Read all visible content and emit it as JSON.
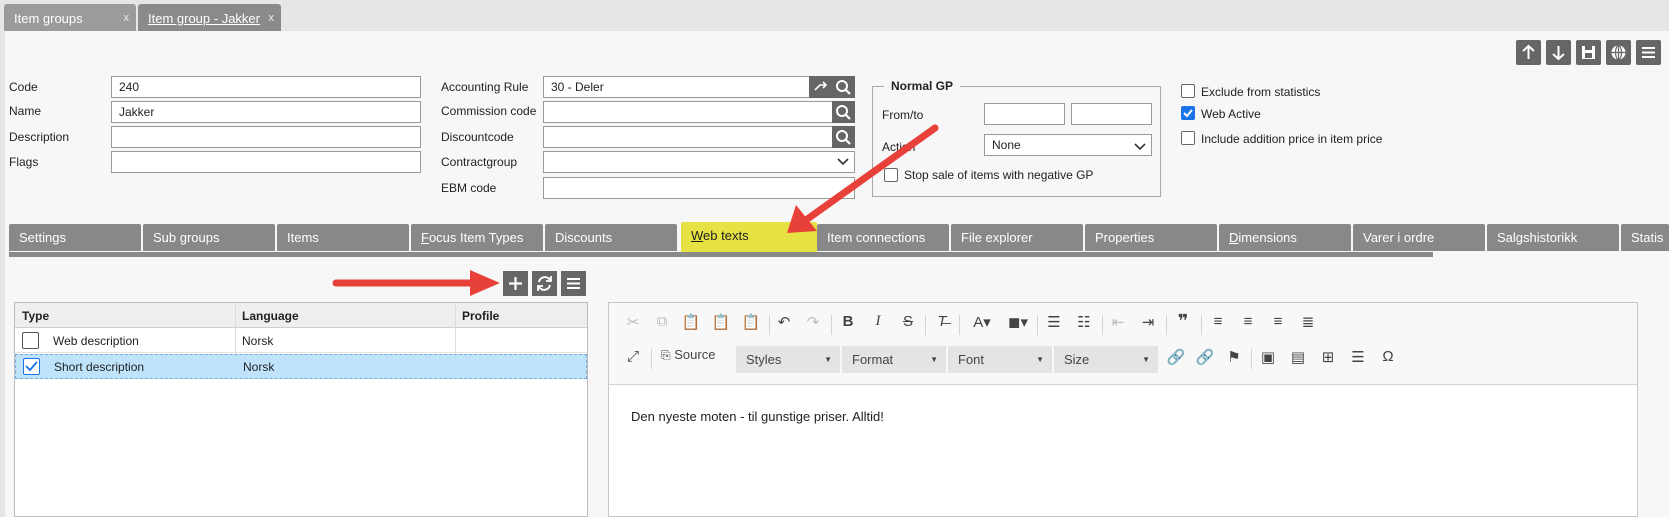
{
  "tabs": [
    {
      "label": "Item groups",
      "close": "x"
    },
    {
      "label": "Item group - Jakker",
      "close": "x"
    }
  ],
  "form": {
    "code_label": "Code",
    "code_value": "240",
    "name_label": "Name",
    "name_value": "Jakker",
    "description_label": "Description",
    "description_value": "",
    "flags_label": "Flags",
    "flags_value": "",
    "accounting_rule_label": "Accounting Rule",
    "accounting_rule_value": "30 - Deler",
    "commission_code_label": "Commission code",
    "commission_code_value": "",
    "discountcode_label": "Discountcode",
    "discountcode_value": "",
    "contractgroup_label": "Contractgroup",
    "contractgroup_value": "",
    "ebm_code_label": "EBM code",
    "ebm_code_value": ""
  },
  "normal_gp": {
    "legend": "Normal GP",
    "from_to_label": "From/to",
    "action_label": "Action",
    "action_value": "None",
    "stop_sale_label": "Stop sale of items with negative GP",
    "stop_sale_checked": false
  },
  "options": {
    "exclude_label": "Exclude from statistics",
    "exclude_checked": false,
    "web_active_label": "Web Active",
    "web_active_checked": true,
    "include_addition_label": "Include addition price in item price",
    "include_addition_checked": false
  },
  "section_tabs": {
    "settings": "Settings",
    "sub_groups": "Sub groups",
    "items": "Items",
    "focus_first": "F",
    "focus_rest": "ocus Item Types",
    "discounts": "Discounts",
    "web_first": "W",
    "web_rest": "eb texts",
    "item_connections": "Item connections",
    "file_explorer": "File explorer",
    "properties": "Properties",
    "dim_first": "D",
    "dim_rest": "imensions",
    "varer": "Varer i ordre",
    "salgshistorikk": "Salgshistorikk",
    "statistics": "Statis"
  },
  "grid": {
    "columns": [
      "Type",
      "Language",
      "Profile"
    ],
    "rows": [
      {
        "type": "Web description",
        "language": "Norsk",
        "profile": "",
        "checked": false
      },
      {
        "type": "Short description",
        "language": "Norsk",
        "profile": "",
        "checked": true
      }
    ]
  },
  "editor": {
    "source_label": "Source",
    "styles_label": "Styles",
    "format_label": "Format",
    "font_label": "Font",
    "size_label": "Size",
    "content": "Den nyeste moten - til gunstige priser. Alltid!"
  },
  "colors": {
    "highlight_tab": "#e6e243",
    "arrow": "#e8413a",
    "selected_row": "#bfe3fb"
  }
}
